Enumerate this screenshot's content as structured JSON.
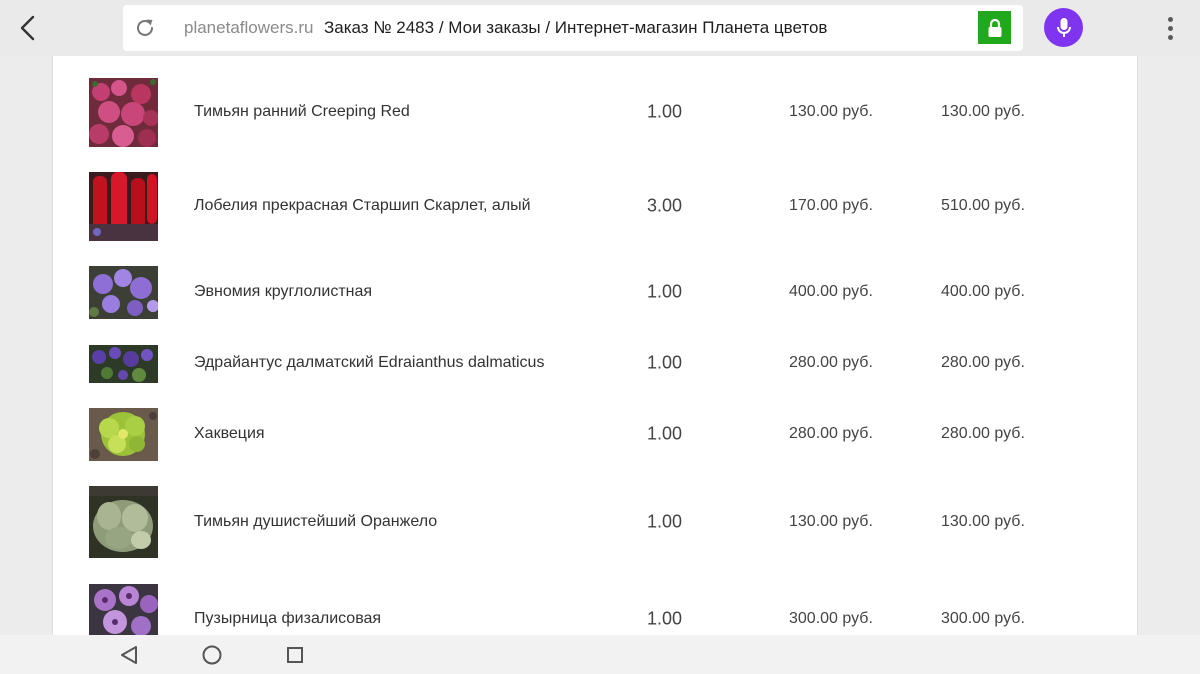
{
  "browser": {
    "domain": "planetaflowers.ru",
    "title": "Заказ № 2483 / Мои заказы / Интернет-магазин Планета цветов"
  },
  "order_items": [
    {
      "name": "Тимьян ранний Creeping Red",
      "qty": "1.00",
      "price": "130.00 руб.",
      "total": "130.00 руб.",
      "image": "red-thyme-photo"
    },
    {
      "name": "Лобелия прекрасная Старшип Скарлет, алый",
      "qty": "3.00",
      "price": "170.00 руб.",
      "total": "510.00 руб.",
      "image": "scarlet-lobelia-photo"
    },
    {
      "name": "Эвномия круглолистная",
      "qty": "1.00",
      "price": "400.00 руб.",
      "total": "400.00 руб.",
      "image": "eunomia-photo"
    },
    {
      "name": "Эдрайантус далматский Edraianthus dalmaticus",
      "qty": "1.00",
      "price": "280.00 руб.",
      "total": "280.00 руб.",
      "image": "edraianthus-photo"
    },
    {
      "name": "Хаквеция",
      "qty": "1.00",
      "price": "280.00 руб.",
      "total": "280.00 руб.",
      "image": "hacquetia-photo"
    },
    {
      "name": "Тимьян душистейший Оранжело",
      "qty": "1.00",
      "price": "130.00 руб.",
      "total": "130.00 руб.",
      "image": "thyme-orangelo-photo"
    },
    {
      "name": "Пузырница физалисовая",
      "qty": "1.00",
      "price": "300.00 руб.",
      "total": "300.00 руб.",
      "image": "physochlaina-photo"
    }
  ],
  "colors": {
    "lock": "#22a81c",
    "mic": "#7f35f0"
  },
  "icons": {
    "back": "chevron-left-icon",
    "reload": "reload-icon",
    "lock": "lock-icon",
    "mic": "microphone-icon",
    "menu": "more-vertical-icon",
    "nav_back": "triangle-back-icon",
    "nav_home": "circle-home-icon",
    "nav_recents": "square-recents-icon"
  }
}
